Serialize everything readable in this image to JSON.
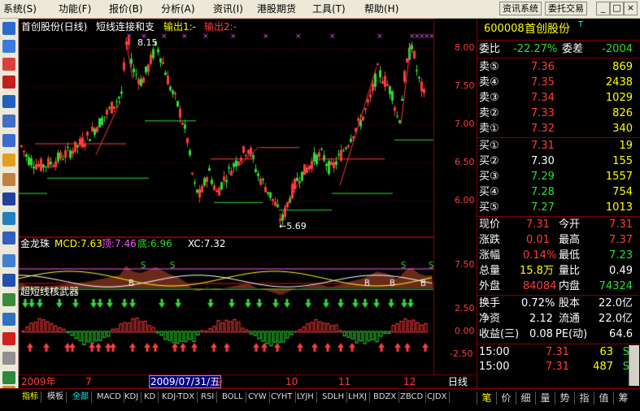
{
  "menu": [
    {
      "label": "系统(S)"
    },
    {
      "label": "功能(F)"
    },
    {
      "label": "报价(B)"
    },
    {
      "label": "分析(A)"
    },
    {
      "label": "资讯(I)"
    },
    {
      "label": "港股期货"
    },
    {
      "label": "工具(T)"
    },
    {
      "label": "帮助(H)"
    }
  ],
  "topbuttons": {
    "news": "资讯系统",
    "trade": "委托交易"
  },
  "window_controls": {
    "min": "_",
    "max": "□",
    "close": "×"
  },
  "chart": {
    "title_stock": "首创股份(日线)",
    "title_indicator": "短线连接和支",
    "out1": "输出1:-",
    "out2": "输出2:-",
    "high_label": "8.15",
    "low_label": "←5.69",
    "price_ticks": [
      "8.00",
      "7.50",
      "7.00",
      "6.50",
      "6.00"
    ],
    "mid_panel": {
      "name": "金龙珠",
      "mcd_label": "MCD:7.63",
      "top_label": "顶:7.46",
      "bottom_label": "底:6.96",
      "xc_label": "XC:7.32",
      "tick": "7.50"
    },
    "low_panel": {
      "name": "超短线核武器",
      "ticks": [
        "2.50",
        "0.00",
        "-2.50"
      ]
    },
    "time_axis": [
      {
        "label": "2009年"
      },
      {
        "label": "7"
      },
      {
        "label": "9"
      },
      {
        "label": "10"
      },
      {
        "label": "11"
      },
      {
        "label": "12"
      }
    ],
    "cursor_date": "2009/07/31/五",
    "period": "日线"
  },
  "quote": {
    "code": "600008",
    "name": "首创股份",
    "tag": "T",
    "weibi_label": "委比",
    "weibi_val": "-22.27%",
    "weicha_label": "委差",
    "weicha_val": "-2004",
    "sell": [
      {
        "label": "卖⑤",
        "price": "7.36",
        "vol": "869"
      },
      {
        "label": "卖④",
        "price": "7.35",
        "vol": "2438"
      },
      {
        "label": "卖③",
        "price": "7.34",
        "vol": "1029"
      },
      {
        "label": "卖②",
        "price": "7.33",
        "vol": "826"
      },
      {
        "label": "卖①",
        "price": "7.32",
        "vol": "340"
      }
    ],
    "buy": [
      {
        "label": "买①",
        "price": "7.31",
        "vol": "19"
      },
      {
        "label": "买②",
        "price": "7.30",
        "vol": "155"
      },
      {
        "label": "买③",
        "price": "7.29",
        "vol": "1557"
      },
      {
        "label": "买④",
        "price": "7.28",
        "vol": "754"
      },
      {
        "label": "买⑤",
        "price": "7.27",
        "vol": "1013"
      }
    ],
    "stats": [
      {
        "l1": "现价",
        "v1": "7.31",
        "l2": "今开",
        "v2": "7.31"
      },
      {
        "l1": "涨跌",
        "v1": "0.01",
        "l2": "最高",
        "v2": "7.37"
      },
      {
        "l1": "涨幅",
        "v1": "0.14%",
        "l2": "最低",
        "v2": "7.23"
      },
      {
        "l1": "总量",
        "v1": "15.8万",
        "l2": "量比",
        "v2": "0.49"
      },
      {
        "l1": "外盘",
        "v1": "84084",
        "l2": "内盘",
        "v2": "74324"
      }
    ],
    "stats2": [
      {
        "l1": "换手",
        "v1": "0.72%",
        "l2": "股本",
        "v2": "22.0亿"
      },
      {
        "l1": "净资",
        "v1": "2.12",
        "l2": "流通",
        "v2": "22.0亿"
      },
      {
        "l1": "收益(三)",
        "v1": "0.08",
        "l2": "PE(动)",
        "v2": "64.6"
      }
    ],
    "ticks": [
      {
        "time": "15:00",
        "price": "7.31",
        "vol": "63",
        "side": "S"
      },
      {
        "time": "15:00",
        "price": "7.31",
        "vol": "487",
        "side": "S"
      }
    ]
  },
  "bottom_tabs": [
    "指标",
    "模板",
    "全部",
    "MACD",
    "KDJ",
    "KD",
    "KDJ-TDX",
    "RSI",
    "BOLL",
    "CYW",
    "CYHT",
    "LYJH",
    "SDLH",
    "LHXJ",
    "BDZX",
    "ZBCD",
    "CJDX"
  ],
  "right_tabs": [
    "笔",
    "价",
    "细",
    "量",
    "势",
    "指",
    "值",
    "筹"
  ],
  "colors": {
    "up": "#ff3c3c",
    "down": "#2fdd2f",
    "bg": "#000000",
    "frame": "#800000"
  }
}
